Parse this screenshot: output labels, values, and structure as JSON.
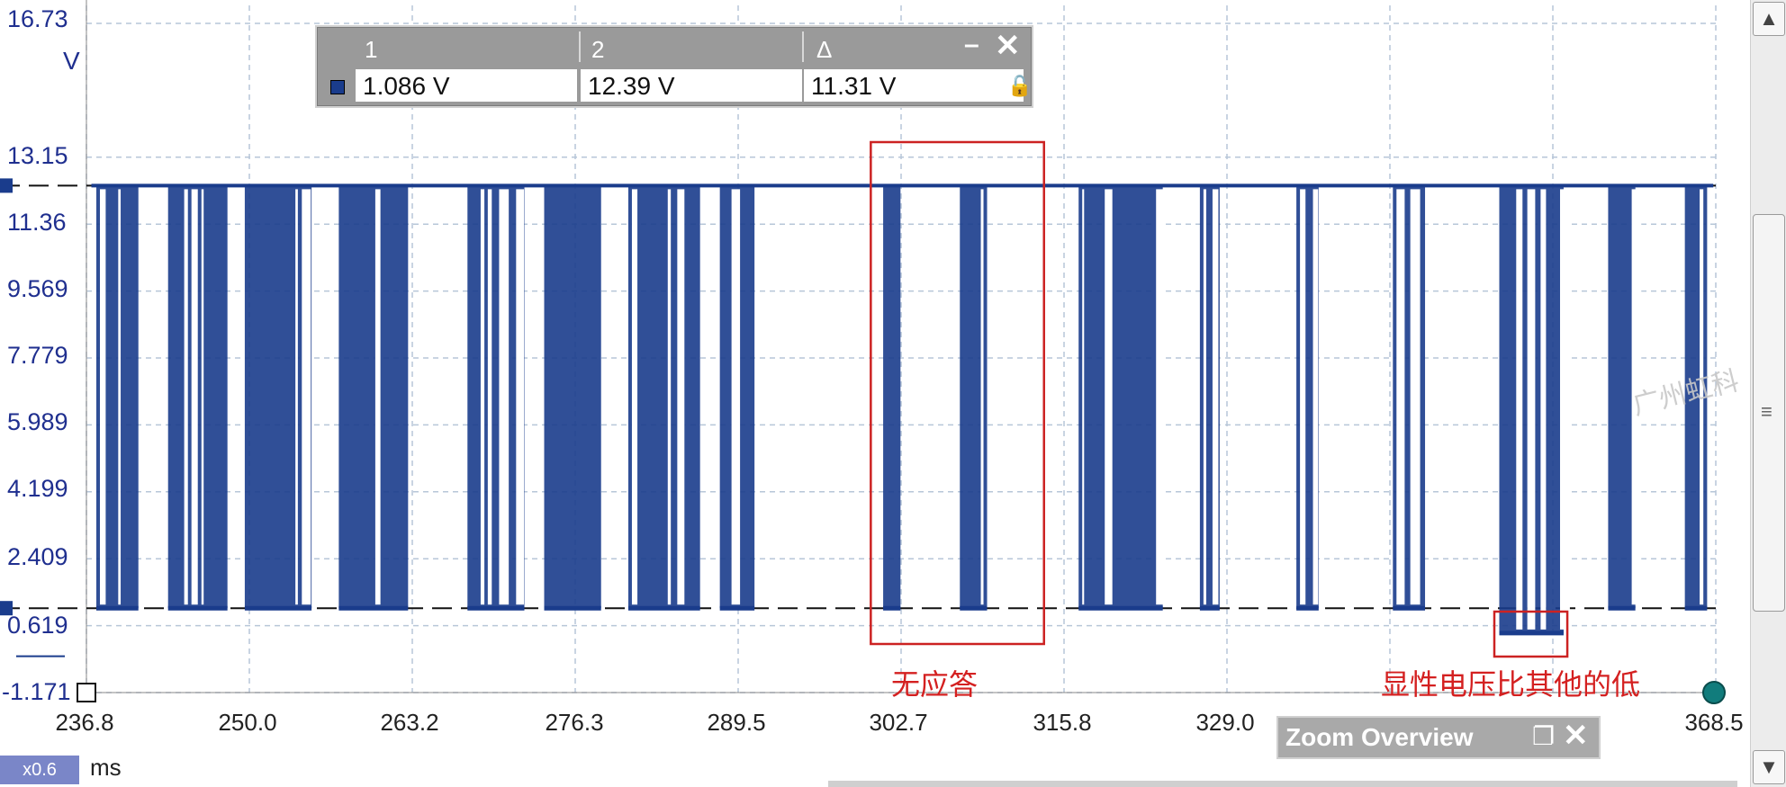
{
  "chart_data": {
    "type": "line",
    "y_unit": "V",
    "x_unit": "ms",
    "y_ticks": [
      "16.73",
      "13.15",
      "11.36",
      "9.569",
      "7.779",
      "5.989",
      "4.199",
      "2.409",
      "0.619",
      "-1.171"
    ],
    "x_ticks": [
      "236.8",
      "250.0",
      "263.2",
      "276.3",
      "289.5",
      "302.7",
      "315.8",
      "329.0",
      "368.5"
    ],
    "xlim": [
      236.8,
      368.5
    ],
    "ylim": [
      -1.171,
      16.73
    ],
    "grid": true,
    "high_level": 12.39,
    "low_level": 1.086,
    "series": [
      {
        "color": "#1a3c8c",
        "bursts": [
          {
            "x0": 237.6,
            "x1": 241.0,
            "low": 1.086
          },
          {
            "x0": 243.4,
            "x1": 248.2,
            "low": 1.086
          },
          {
            "x0": 249.6,
            "x1": 255.0,
            "low": 1.086
          },
          {
            "x0": 257.2,
            "x1": 262.8,
            "low": 1.086
          },
          {
            "x0": 267.6,
            "x1": 272.2,
            "low": 1.086
          },
          {
            "x0": 273.8,
            "x1": 278.4,
            "low": 1.086
          },
          {
            "x0": 280.6,
            "x1": 286.4,
            "low": 1.086
          },
          {
            "x0": 288.0,
            "x1": 290.8,
            "low": 1.086
          },
          {
            "x0": 301.2,
            "x1": 302.6,
            "low": 1.086
          },
          {
            "x0": 307.4,
            "x1": 309.6,
            "low": 1.086
          },
          {
            "x0": 317.0,
            "x1": 323.8,
            "low": 1.086
          },
          {
            "x0": 326.8,
            "x1": 328.4,
            "low": 1.086
          },
          {
            "x0": 334.6,
            "x1": 336.4,
            "low": 1.086
          },
          {
            "x0": 342.4,
            "x1": 345.0,
            "low": 1.086
          },
          {
            "x0": 351.0,
            "x1": 356.2,
            "low": 0.42
          },
          {
            "x0": 359.8,
            "x1": 362.0,
            "low": 1.086
          },
          {
            "x0": 366.0,
            "x1": 367.8,
            "low": 1.086
          }
        ]
      }
    ],
    "annotations": [
      "无应答",
      "显性电压比其他的低"
    ]
  },
  "zoom_factor": "x0.6",
  "measurement": {
    "col1_header": "1",
    "col2_header": "2",
    "col3_header": "Δ",
    "val1": "1.086 V",
    "val2": "12.39 V",
    "val3": "11.31 V",
    "swatch_color": "#1a3c8c"
  },
  "zoom_overview": {
    "title": "Zoom Overview"
  },
  "watermark": "广州虹科"
}
